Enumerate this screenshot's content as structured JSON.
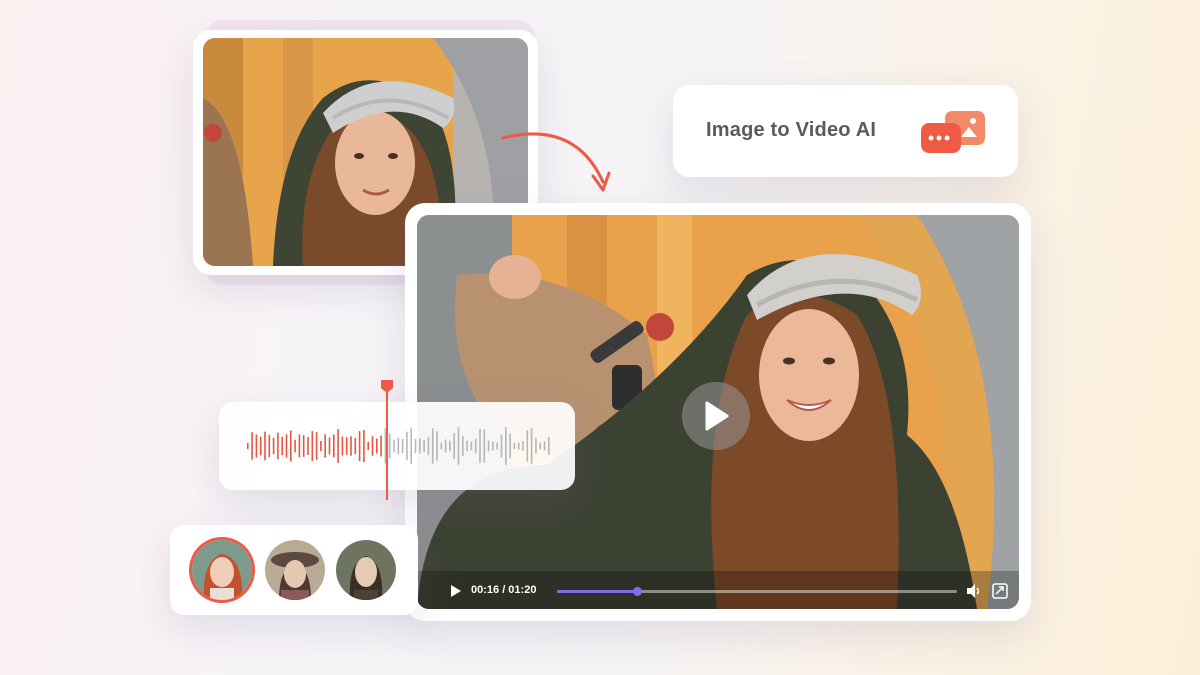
{
  "label_card": {
    "title": "Image to Video AI",
    "badge_icon": "image-chat-icon"
  },
  "source_image": {
    "alt_subject": ""
  },
  "video_player": {
    "time_display": "00:16 / 01:20",
    "progress": 0.2,
    "play_icon": "play-icon",
    "small_play_icon": "play-small-icon",
    "volume_icon": "volume-icon",
    "fullscreen_icon": "fullscreen-icon",
    "progress_color": "#7b6cf0"
  },
  "audio_waveform": {
    "played_color": "#e6553f",
    "unplayed_color": "#9a9a9a",
    "marker_color": "#e6553f"
  },
  "avatars": [
    {
      "name": "avatar-1",
      "selected": true
    },
    {
      "name": "avatar-2",
      "selected": false
    },
    {
      "name": "avatar-3",
      "selected": false
    }
  ],
  "accent_color": "#ef5a45"
}
